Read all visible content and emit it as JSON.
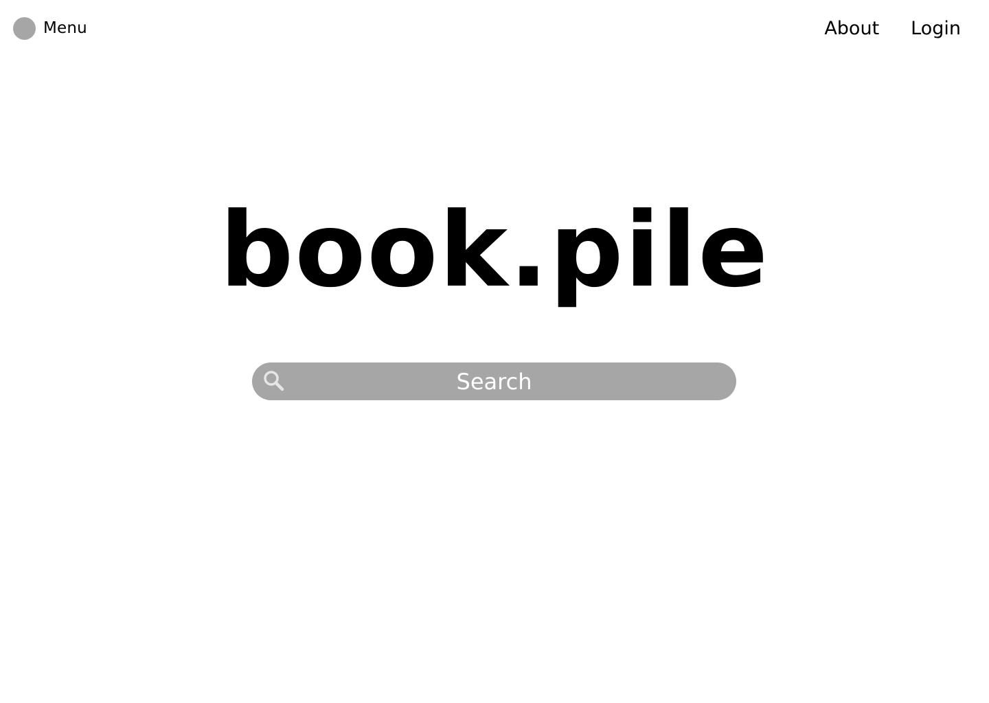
{
  "header": {
    "menu_label": "Menu",
    "nav": [
      {
        "label": "About"
      },
      {
        "label": "Login"
      }
    ]
  },
  "main": {
    "logo_text": "book.pile",
    "search": {
      "placeholder": "Search",
      "value": ""
    }
  },
  "icons": {
    "menu": "circle-menu-icon",
    "search": "search-icon"
  },
  "colors": {
    "background": "#ffffff",
    "text": "#000000",
    "accent_gray": "#a6a6a6",
    "search_text": "#ffffff"
  }
}
